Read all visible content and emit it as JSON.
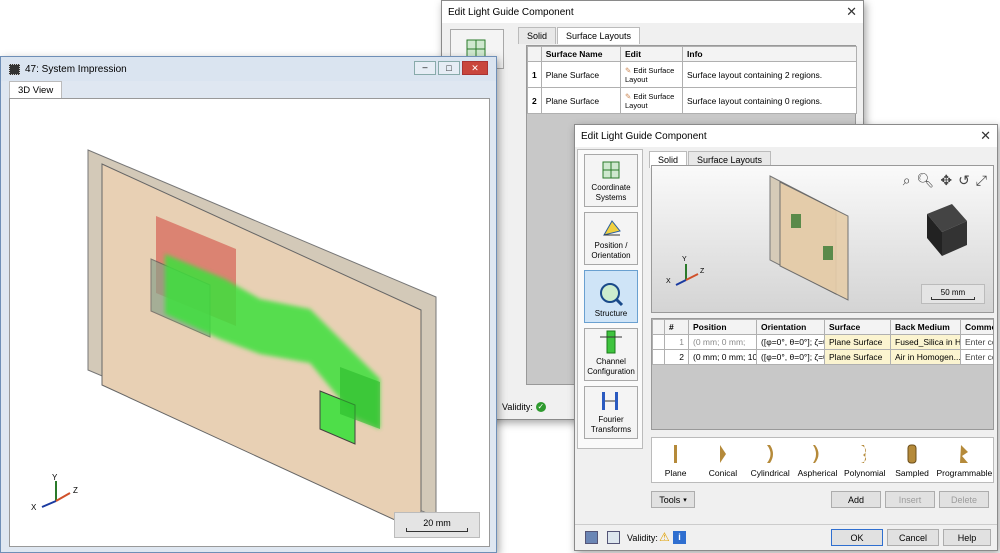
{
  "back_dialog": {
    "title": "Edit Light Guide Component",
    "tabs": [
      "Solid",
      "Surface Layouts"
    ],
    "table": {
      "headers": [
        "Surface Name",
        "Edit",
        "Info"
      ],
      "rows": [
        {
          "num": "1",
          "name": "Plane Surface",
          "edit": "Edit Surface Layout",
          "info": "Surface layout containing 2 regions."
        },
        {
          "num": "2",
          "name": "Plane Surface",
          "edit": "Edit Surface Layout",
          "info": "Surface layout containing 0 regions."
        }
      ]
    },
    "validity_label": "Validity:"
  },
  "impression": {
    "title": "47: System Impression",
    "tab": "3D View",
    "scale": "20 mm",
    "axes": {
      "x": "X",
      "y": "Y",
      "z": "Z"
    }
  },
  "front_dialog": {
    "title": "Edit Light Guide Component",
    "tabs": [
      "Solid",
      "Surface Layouts"
    ],
    "sidebar": [
      "Coordinate Systems",
      "Position / Orientation",
      "Structure",
      "Channel Configuration",
      "Fourier Transforms"
    ],
    "preview_scale": "50 mm",
    "preview_axes": {
      "x": "X",
      "y": "Y",
      "z": "Z"
    },
    "table": {
      "headers": [
        "#",
        "Position",
        "Orientation",
        "Surface",
        "Back Medium",
        "Comme"
      ],
      "rows": [
        {
          "num": "1",
          "position": "(0 mm; 0 mm;",
          "orientation": "([φ=0°, θ=0°]; ζ=0°",
          "surface": "Plane Surface",
          "medium": "Fused_Silica in H...",
          "comment": "Enter co"
        },
        {
          "num": "2",
          "position": "(0 mm; 0 mm; 10 m",
          "orientation": "([φ=0°, θ=0°]; ζ=0°",
          "surface": "Plane Surface",
          "medium": "Air in Homogen...",
          "comment": "Enter co"
        }
      ]
    },
    "surface_types": [
      "Plane",
      "Conical",
      "Cylindrical",
      "Aspherical",
      "Polynomial",
      "Sampled",
      "Programmable"
    ],
    "tools": "Tools",
    "buttons": {
      "add": "Add",
      "insert": "Insert",
      "delete": "Delete",
      "ok": "OK",
      "cancel": "Cancel",
      "help": "Help"
    },
    "validity_label": "Validity:"
  }
}
